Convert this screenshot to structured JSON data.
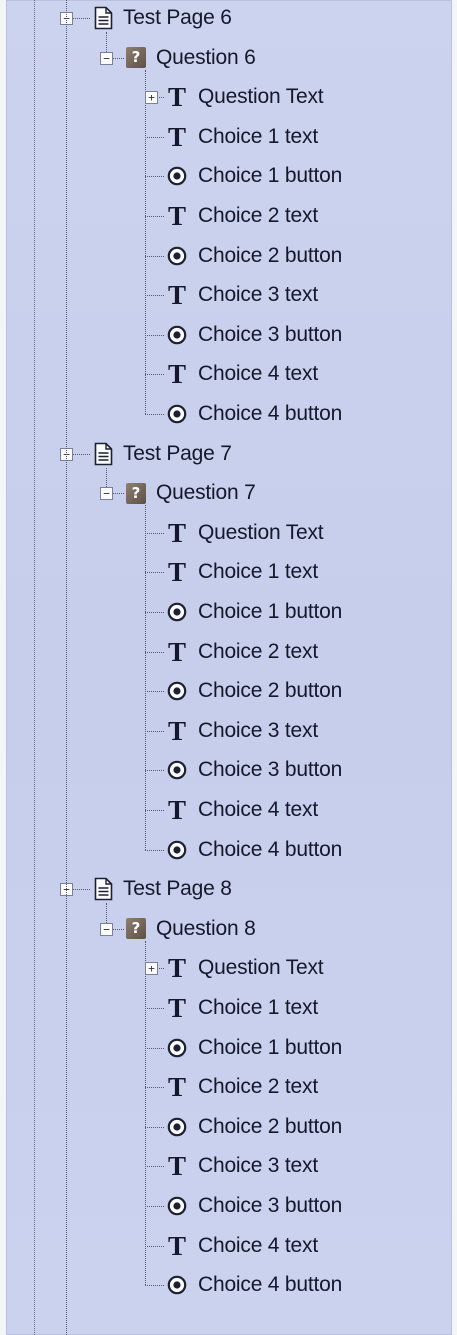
{
  "tree": {
    "pages": [
      {
        "title": "Test Page 6",
        "question": "Question 6",
        "children": [
          {
            "label": "Question Text",
            "icon": "text-icon",
            "expandable": true
          },
          {
            "label": "Choice 1 text",
            "icon": "text-icon"
          },
          {
            "label": "Choice 1 button",
            "icon": "radio-button-icon"
          },
          {
            "label": "Choice 2 text",
            "icon": "text-icon"
          },
          {
            "label": "Choice 2 button",
            "icon": "radio-button-icon"
          },
          {
            "label": "Choice 3 text",
            "icon": "text-icon"
          },
          {
            "label": "Choice 3 button",
            "icon": "radio-button-icon"
          },
          {
            "label": "Choice 4 text",
            "icon": "text-icon"
          },
          {
            "label": "Choice 4 button",
            "icon": "radio-button-icon"
          }
        ]
      },
      {
        "title": "Test Page 7",
        "question": "Question 7",
        "children": [
          {
            "label": "Question Text",
            "icon": "text-icon",
            "expandable": false
          },
          {
            "label": "Choice 1 text",
            "icon": "text-icon"
          },
          {
            "label": "Choice 1 button",
            "icon": "radio-button-icon"
          },
          {
            "label": "Choice 2 text",
            "icon": "text-icon"
          },
          {
            "label": "Choice 2 button",
            "icon": "radio-button-icon"
          },
          {
            "label": "Choice 3 text",
            "icon": "text-icon"
          },
          {
            "label": "Choice 3 button",
            "icon": "radio-button-icon"
          },
          {
            "label": "Choice 4 text",
            "icon": "text-icon"
          },
          {
            "label": "Choice 4 button",
            "icon": "radio-button-icon"
          }
        ]
      },
      {
        "title": "Test Page 8",
        "question": "Question 8",
        "children": [
          {
            "label": "Question Text",
            "icon": "text-icon",
            "expandable": true
          },
          {
            "label": "Choice 1 text",
            "icon": "text-icon"
          },
          {
            "label": "Choice 1 button",
            "icon": "radio-button-icon"
          },
          {
            "label": "Choice 2 text",
            "icon": "text-icon"
          },
          {
            "label": "Choice 2 button",
            "icon": "radio-button-icon"
          },
          {
            "label": "Choice 3 text",
            "icon": "text-icon"
          },
          {
            "label": "Choice 3 button",
            "icon": "radio-button-icon"
          },
          {
            "label": "Choice 4 text",
            "icon": "text-icon"
          },
          {
            "label": "Choice 4 button",
            "icon": "radio-button-icon"
          }
        ]
      }
    ],
    "toggle_collapse": "−",
    "toggle_expand": "+",
    "colors": {
      "panel_background": "#c9d0ed",
      "question_icon": "#6e6055",
      "text": "#15182a"
    }
  }
}
